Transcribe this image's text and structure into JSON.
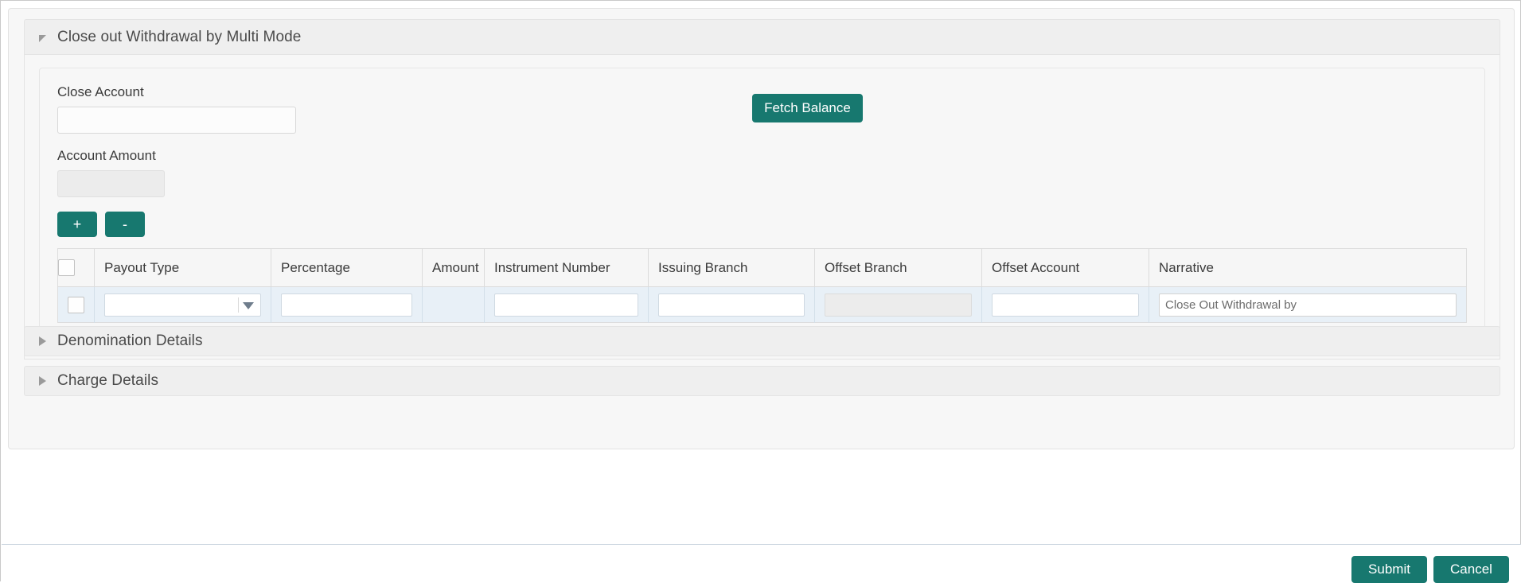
{
  "theme": {
    "accent_teal": "#17786f",
    "row_blue": "#e8f0f7",
    "panel_header_gray": "#efefef",
    "page_background": "#ffffff"
  },
  "panel": {
    "title": "Close out Withdrawal by Multi Mode",
    "toggle_icon": "triangle-expanded-icon",
    "expanded": true
  },
  "form": {
    "close_account": {
      "label": "Close Account",
      "value": "",
      "placeholder": ""
    },
    "account_amount": {
      "label": "Account Amount",
      "value": "",
      "placeholder": "",
      "disabled": true
    },
    "fetch_balance_button": "Fetch Balance",
    "add_row_button": "+",
    "remove_row_button": "-"
  },
  "grid": {
    "select_all_checkbox": false,
    "columns": [
      "Payout Type",
      "Percentage",
      "Amount",
      "Instrument Number",
      "Issuing Branch",
      "Offset Branch",
      "Offset Account",
      "Narrative"
    ],
    "rows": [
      {
        "selected": false,
        "payout_type": "",
        "payout_type_icon": "chevron-down-icon",
        "percentage": "",
        "amount": "",
        "instrument_number": "",
        "issuing_branch": "",
        "offset_branch": "",
        "offset_branch_disabled": true,
        "offset_account": "",
        "narrative": "Close Out Withdrawal by"
      }
    ]
  },
  "accordions": [
    {
      "title": "Denomination Details",
      "toggle_icon": "triangle-collapsed-icon",
      "expanded": false
    },
    {
      "title": "Charge Details",
      "toggle_icon": "triangle-collapsed-icon",
      "expanded": false
    }
  ],
  "footer": {
    "submit_label": "Submit",
    "cancel_label": "Cancel"
  }
}
